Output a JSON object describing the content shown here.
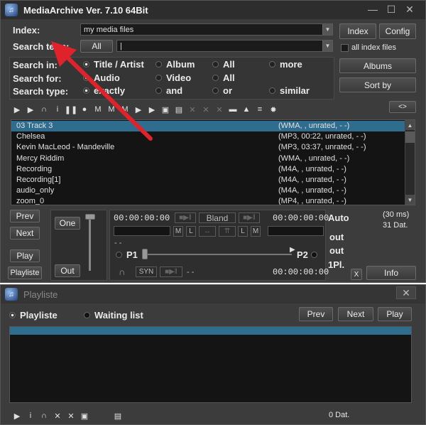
{
  "main": {
    "title": "MediaArchive Ver. 7.10 64Bit",
    "index_label": "Index:",
    "index_value": "my media files",
    "index_button": "Index",
    "config_button": "Config",
    "search_term_label": "Search term:",
    "all_button": "All",
    "search_value": "",
    "all_index_files": "all index files",
    "search_in": {
      "label": "Search in:",
      "options": [
        "Title / Artist",
        "Album",
        "All",
        "more"
      ]
    },
    "search_for": {
      "label": "Search for:",
      "options": [
        "Audio",
        "Video",
        "All"
      ]
    },
    "search_type": {
      "label": "Search type:",
      "options": [
        "exactly",
        "and",
        "or",
        "similar"
      ]
    },
    "albums_button": "Albums",
    "sortby_button": "Sort by",
    "toggle_button": "<>",
    "list": [
      {
        "name": "03 Track 3",
        "info": "(WMA, , unrated, - -)"
      },
      {
        "name": "Chelsea",
        "info": "(MP3, 00:22, unrated, - -)"
      },
      {
        "name": "Kevin MacLeod - Mandeville",
        "info": "(MP3, 03:37, unrated, - -)"
      },
      {
        "name": "Mercy Riddim",
        "info": "(WMA, , unrated, - -)"
      },
      {
        "name": "Recording",
        "info": "(M4A, , unrated, - -)"
      },
      {
        "name": "Recording[1]",
        "info": "(M4A, , unrated, - -)"
      },
      {
        "name": "audio_only",
        "info": "(M4A, , unrated, - -)"
      },
      {
        "name": "zoom_0",
        "info": "(MP4, , unrated, - -)"
      }
    ],
    "player": {
      "prev": "Prev",
      "next": "Next",
      "play": "Play",
      "playliste": "Playliste",
      "one": "One",
      "out": "Out",
      "time1": "00:00:00:00",
      "time2": "00:00:00:00",
      "time3": "00:00:00:00",
      "bland": "Bland",
      "m": "M",
      "l": "L",
      "p1": "P1",
      "p2": "P2",
      "syn": "SYN",
      "dashes1": "- -",
      "dashes2": "- -",
      "auto": "Auto",
      "out1": "out",
      "out2": "out",
      "onepl": "1Pl.",
      "x": "X",
      "ms": "(30 ms)",
      "dat": "31 Dat.",
      "info": "Info"
    }
  },
  "playlist": {
    "title": "Playliste",
    "tab_playliste": "Playliste",
    "tab_waiting": "Waiting list",
    "prev": "Prev",
    "next": "Next",
    "play": "Play",
    "count": "0 Dat."
  },
  "colors": {
    "accent": "#2f6d8f",
    "annotation_arrow": "#e0232b"
  }
}
